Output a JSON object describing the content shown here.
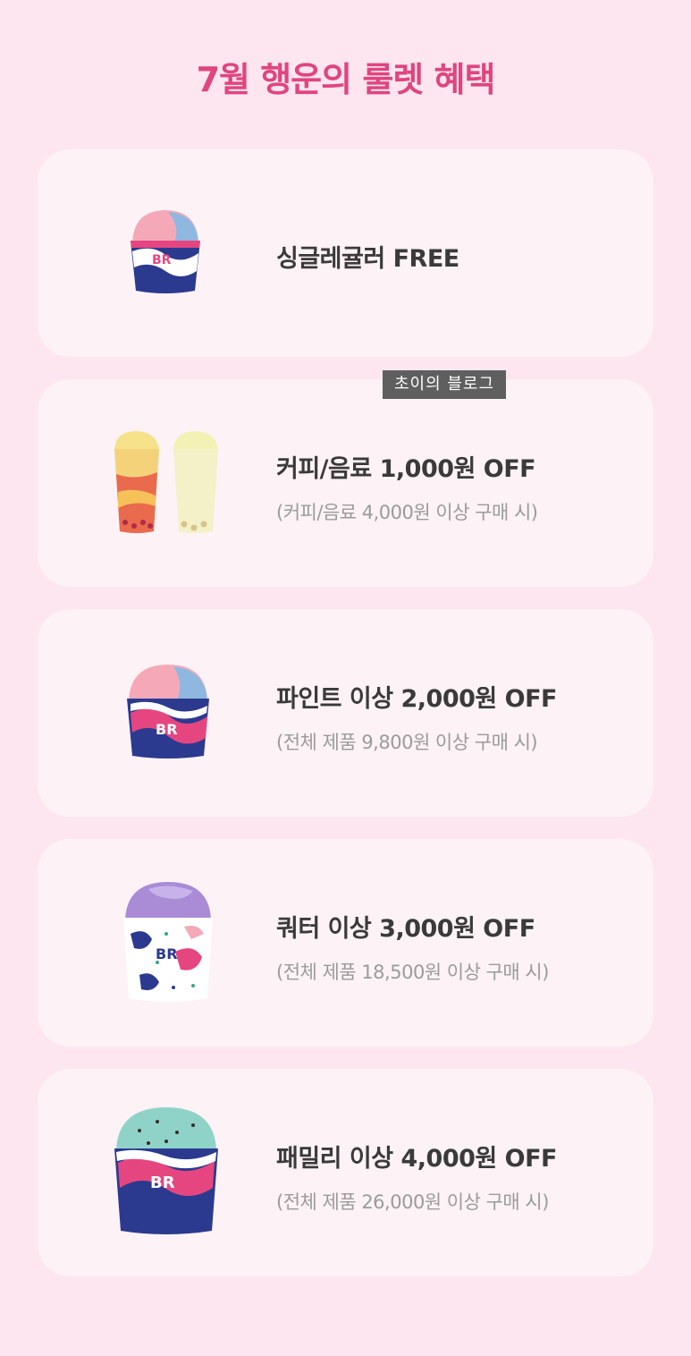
{
  "title": "7월 행운의 룰렛 혜택",
  "watermark": "초이의 블로그",
  "colors": {
    "background": "#fde6ef",
    "card": "#fdf2f6",
    "title": "#e0457e"
  },
  "benefits": [
    {
      "product": "single-regular-cup",
      "title": "싱글레귤러 FREE",
      "condition": ""
    },
    {
      "product": "drinks",
      "title": "커피/음료 1,000원 OFF",
      "condition": "(커피/음료 4,000원 이상 구매 시)"
    },
    {
      "product": "pint-cup",
      "title": "파인트 이상 2,000원 OFF",
      "condition": "(전체 제품 9,800원 이상 구매 시)"
    },
    {
      "product": "quarter-cup",
      "title": "쿼터 이상 3,000원 OFF",
      "condition": "(전체 제품 18,500원 이상 구매 시)"
    },
    {
      "product": "family-cup",
      "title": "패밀리 이상 4,000원 OFF",
      "condition": "(전체 제품 26,000원 이상 구매 시)"
    }
  ]
}
